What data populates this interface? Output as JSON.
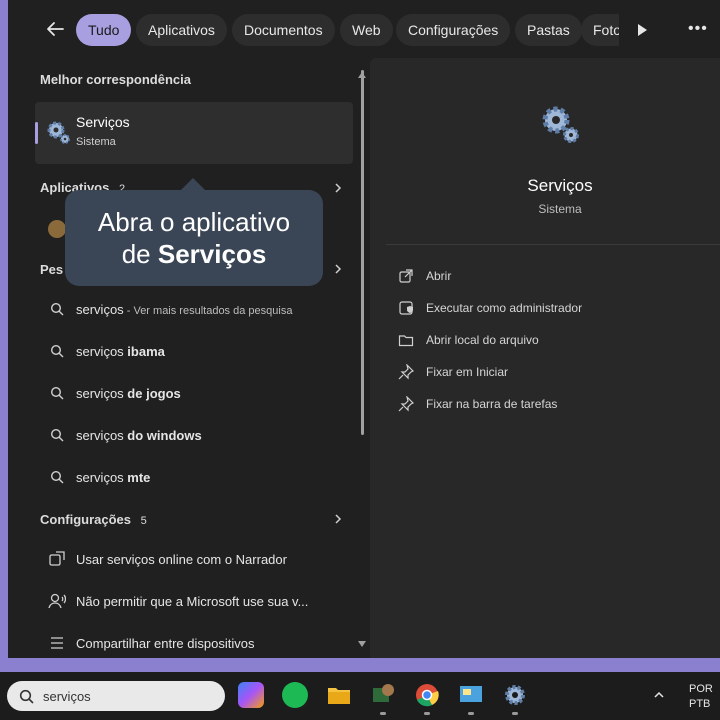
{
  "filters": [
    "Tudo",
    "Aplicativos",
    "Documentos",
    "Web",
    "Configurações",
    "Pastas",
    "Foto"
  ],
  "best_match": {
    "header": "Melhor correspondência",
    "title": "Serviços",
    "subtitle": "Sistema"
  },
  "apps": {
    "header": "Aplicativos",
    "count": "2"
  },
  "web_search": {
    "header": "Pes",
    "items": [
      {
        "query": "serviços",
        "bold": "",
        "hint": " - Ver mais resultados da pesquisa"
      },
      {
        "query": "serviços ",
        "bold": "ibama",
        "hint": ""
      },
      {
        "query": "serviços ",
        "bold": "de jogos",
        "hint": ""
      },
      {
        "query": "serviços ",
        "bold": "do windows",
        "hint": ""
      },
      {
        "query": "serviços ",
        "bold": "mte",
        "hint": ""
      }
    ]
  },
  "settings": {
    "header": "Configurações",
    "count": "5",
    "items": [
      "Usar serviços online com o Narrador",
      "Não permitir que a Microsoft use sua v...",
      "Compartilhar entre dispositivos"
    ]
  },
  "detail": {
    "name": "Serviços",
    "type": "Sistema",
    "actions": [
      "Abrir",
      "Executar como administrador",
      "Abrir local do arquivo",
      "Fixar em Iniciar",
      "Fixar na barra de tarefas"
    ]
  },
  "tooltip": {
    "line1": "Abra o aplicativo",
    "line2_prefix": "de ",
    "line2_bold": "Serviços"
  },
  "taskbar": {
    "search_value": "serviços",
    "lang_line1": "POR",
    "lang_line2": "PTB"
  },
  "colors": {
    "accent": "#a79fe0",
    "panel": "#202020",
    "detail_bg": "#282828",
    "tooltip_bg": "#3a4656",
    "desktop": "#8b7fd0"
  },
  "icons": [
    "back-arrow-icon",
    "play-icon",
    "more-icon",
    "gear-icon",
    "search-icon",
    "chevron-right-icon",
    "open-icon",
    "admin-icon",
    "folder-icon",
    "pin-icon"
  ]
}
